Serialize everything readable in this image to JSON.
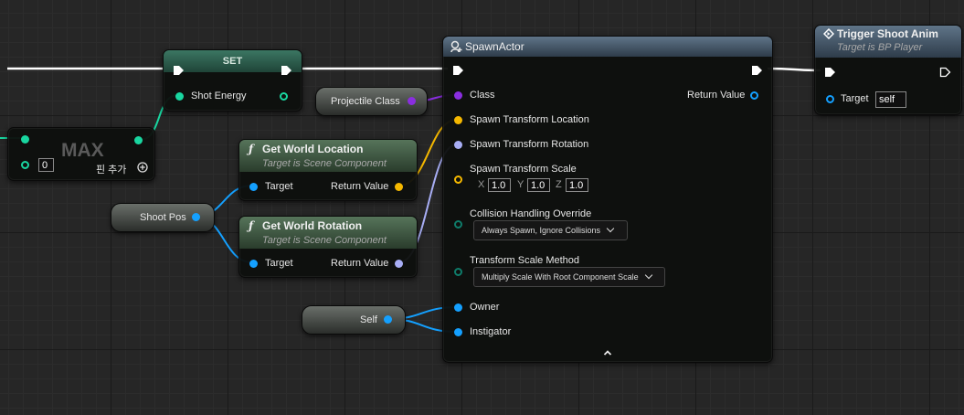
{
  "set_node": {
    "title": "SET",
    "pin_shot_energy": "Shot Energy"
  },
  "max_node": {
    "title": "MAX",
    "input_value": "0",
    "add_pin_label": "핀 추가"
  },
  "get_world_location": {
    "title": "Get World Location",
    "subtitle": "Target is Scene Component",
    "target": "Target",
    "return_value": "Return Value"
  },
  "get_world_rotation": {
    "title": "Get World Rotation",
    "subtitle": "Target is Scene Component",
    "target": "Target",
    "return_value": "Return Value"
  },
  "shoot_pos": {
    "label": "Shoot Pos"
  },
  "projectile_class": {
    "label": "Projectile Class"
  },
  "self_node": {
    "label": "Self"
  },
  "spawn_actor": {
    "title": "SpawnActor",
    "class": "Class",
    "return_value": "Return Value",
    "spawn_location": "Spawn Transform Location",
    "spawn_rotation": "Spawn Transform Rotation",
    "spawn_scale": "Spawn Transform Scale",
    "scale_x_label": "X",
    "scale_x": "1.0",
    "scale_y_label": "Y",
    "scale_y": "1.0",
    "scale_z_label": "Z",
    "scale_z": "1.0",
    "collision_label": "Collision Handling Override",
    "collision_value": "Always Spawn, Ignore Collisions",
    "scale_method_label": "Transform Scale Method",
    "scale_method_value": "Multiply Scale With Root Component Scale",
    "owner": "Owner",
    "instigator": "Instigator"
  },
  "trigger_shoot": {
    "title": "Trigger Shoot Anim",
    "subtitle": "Target is BP Player",
    "target": "Target",
    "target_value": "self"
  },
  "colors": {
    "exec": "#ffffff",
    "object_ref": "#14a0ff",
    "float": "#19d6a0",
    "class": "#8a2ee0",
    "vector": "#f5b800",
    "rotator": "#a8aef5",
    "enum": "#0e7c6a",
    "set_header": "#2f5f50",
    "function_header": "#3f5a44",
    "spawn_header": "#3b5068"
  },
  "icons": [
    "exec-pin-icon",
    "function-icon",
    "spawn-actor-icon",
    "event-call-icon",
    "add-pin-icon",
    "collapse-arrow-icon"
  ]
}
